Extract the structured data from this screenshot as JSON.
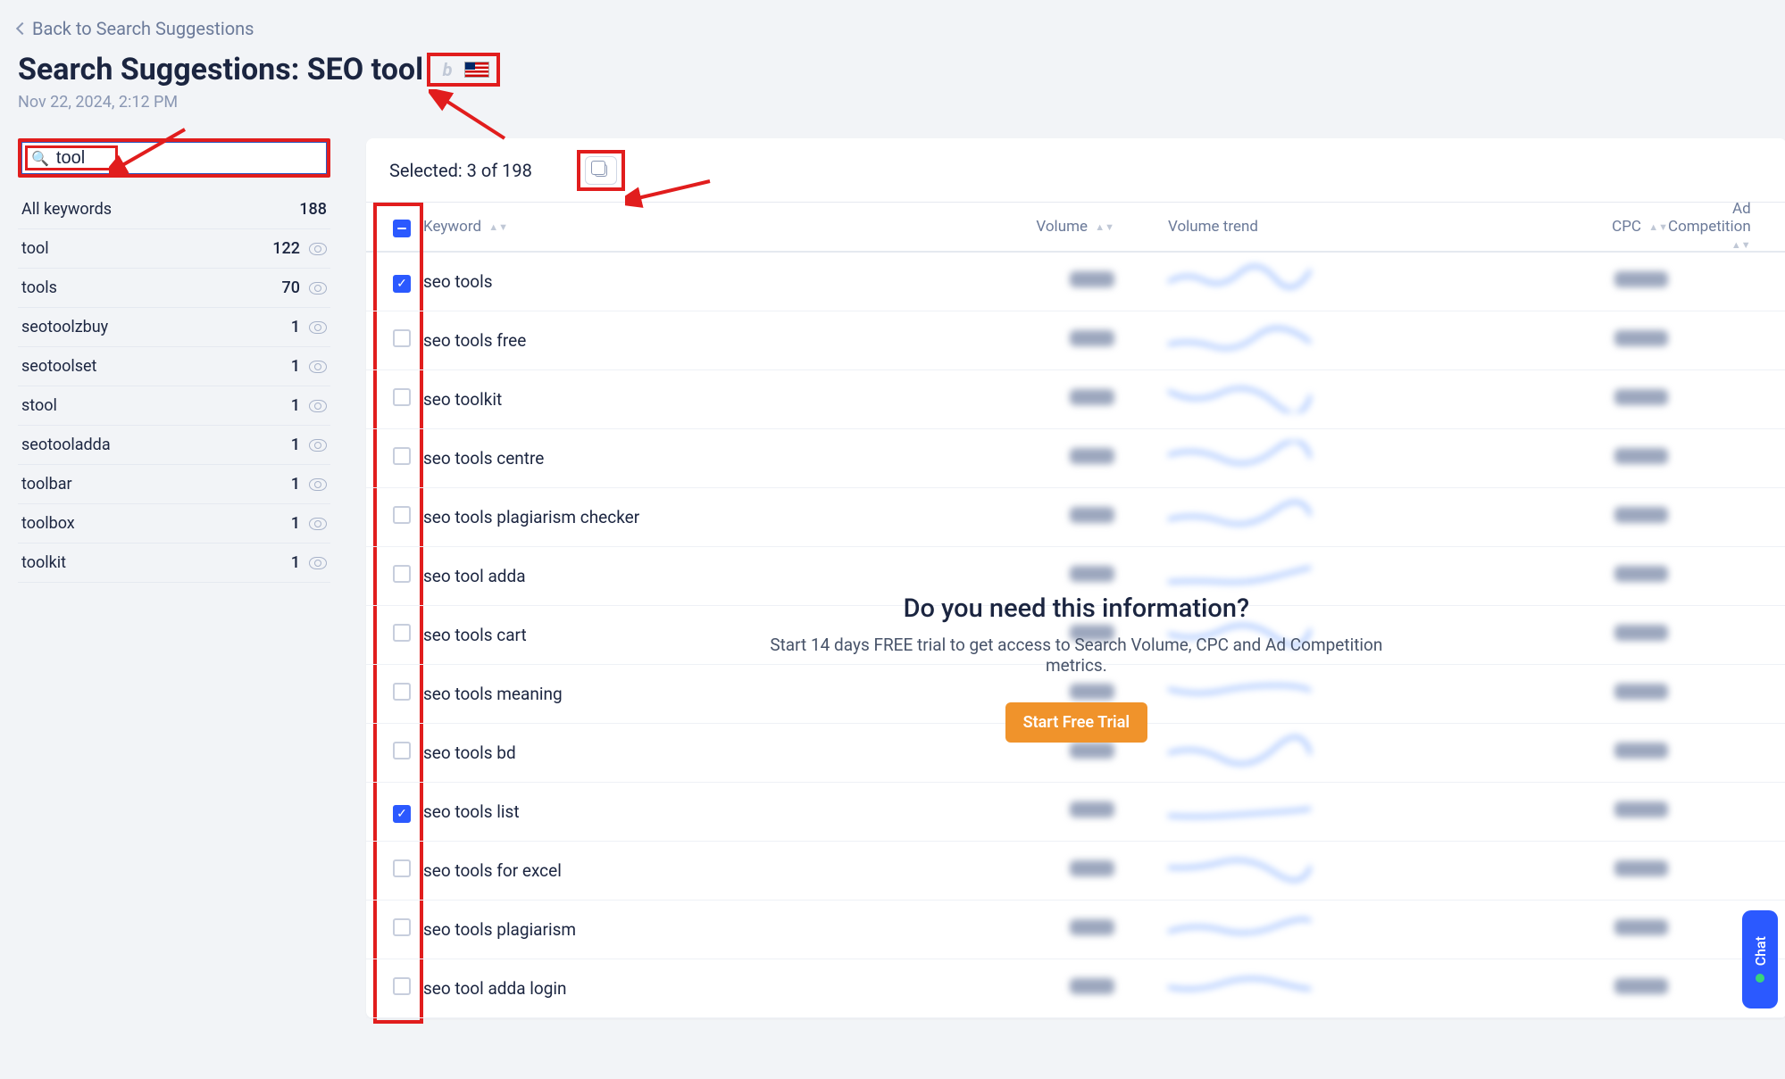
{
  "back_link": "Back to Search Suggestions",
  "page_title_prefix": "Search Suggestions: ",
  "page_title_query": "SEO tool",
  "timestamp": "Nov 22, 2024, 2:12 PM",
  "search": {
    "value": "tool"
  },
  "sidebar": {
    "all_label": "All keywords",
    "all_count": "188",
    "items": [
      {
        "label": "tool",
        "count": "122"
      },
      {
        "label": "tools",
        "count": "70"
      },
      {
        "label": "seotoolzbuy",
        "count": "1"
      },
      {
        "label": "seotoolset",
        "count": "1"
      },
      {
        "label": "stool",
        "count": "1"
      },
      {
        "label": "seotooladda",
        "count": "1"
      },
      {
        "label": "toolbar",
        "count": "1"
      },
      {
        "label": "toolbox",
        "count": "1"
      },
      {
        "label": "toolkit",
        "count": "1"
      }
    ]
  },
  "selected_text": "Selected: 3 of 198",
  "columns": {
    "keyword": "Keyword",
    "volume": "Volume",
    "volume_trend": "Volume trend",
    "cpc": "CPC",
    "ad_competition": "Ad Competition"
  },
  "rows": [
    {
      "keyword": "seo tools",
      "checked": true,
      "adc_color": "green"
    },
    {
      "keyword": "seo tools free",
      "checked": false,
      "adc_color": "yellow"
    },
    {
      "keyword": "seo toolkit",
      "checked": false,
      "adc_color": "yellow"
    },
    {
      "keyword": "seo tools centre",
      "checked": false,
      "adc_color": "red"
    },
    {
      "keyword": "seo tools plagiarism checker",
      "checked": false,
      "adc_color": "yellow"
    },
    {
      "keyword": "seo tool adda",
      "checked": false,
      "adc_color": "yellow"
    },
    {
      "keyword": "seo tools cart",
      "checked": false,
      "adc_color": "red"
    },
    {
      "keyword": "seo tools meaning",
      "checked": false,
      "adc_color": "green"
    },
    {
      "keyword": "seo tools bd",
      "checked": false,
      "adc_color": "green"
    },
    {
      "keyword": "seo tools list",
      "checked": true,
      "adc_color": "yellow"
    },
    {
      "keyword": "seo tools for excel",
      "checked": false,
      "adc_color": "green"
    },
    {
      "keyword": "seo tools plagiarism",
      "checked": false,
      "adc_color": "green"
    },
    {
      "keyword": "seo tool adda login",
      "checked": false,
      "adc_color": "green"
    }
  ],
  "trial": {
    "title": "Do you need this information?",
    "subtitle": "Start 14 days FREE trial to get access to Search Volume, CPC and Ad Competition metrics.",
    "button": "Start Free Trial"
  },
  "chat_label": "Chat"
}
